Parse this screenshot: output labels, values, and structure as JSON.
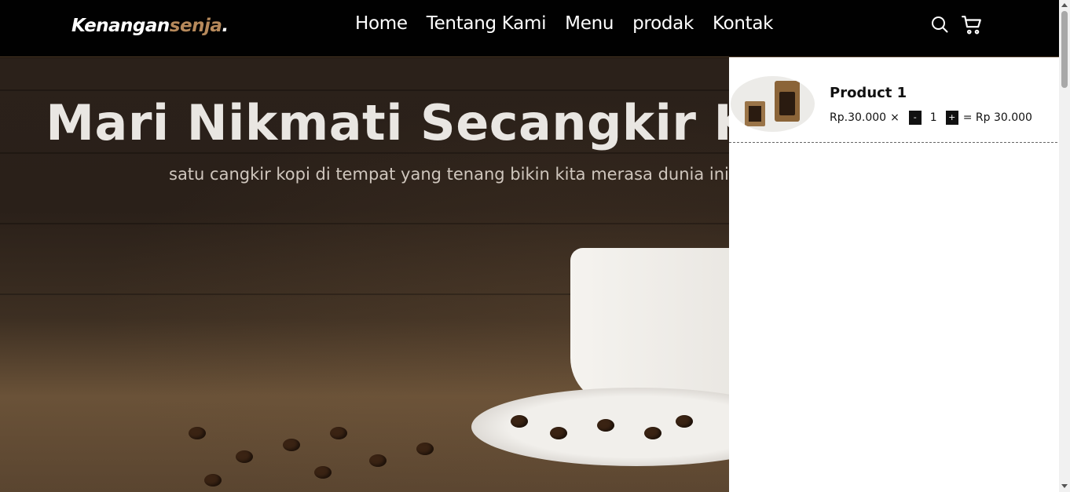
{
  "brand": {
    "name_main": "Kenangan",
    "name_accent": "senja",
    "dot": "."
  },
  "nav": {
    "items": [
      {
        "label": "Home"
      },
      {
        "label": "Tentang Kami"
      },
      {
        "label": "Menu"
      },
      {
        "label": "prodak"
      },
      {
        "label": "Kontak"
      }
    ]
  },
  "icons": {
    "search": "search-icon",
    "cart": "cart-icon"
  },
  "hero": {
    "title": "Mari Nikmati Secangkir Kopi",
    "subtitle": "satu cangkir kopi di tempat yang tenang bikin kita merasa dunia ini milik kita"
  },
  "cart": {
    "items": [
      {
        "name": "Product 1",
        "price": "Rp.30.000",
        "times": "×",
        "minus": "-",
        "qty": "1",
        "plus": "+",
        "total": "= Rp 30.000"
      }
    ]
  },
  "colors": {
    "accent": "#b6895b",
    "navbar": "#010101"
  }
}
